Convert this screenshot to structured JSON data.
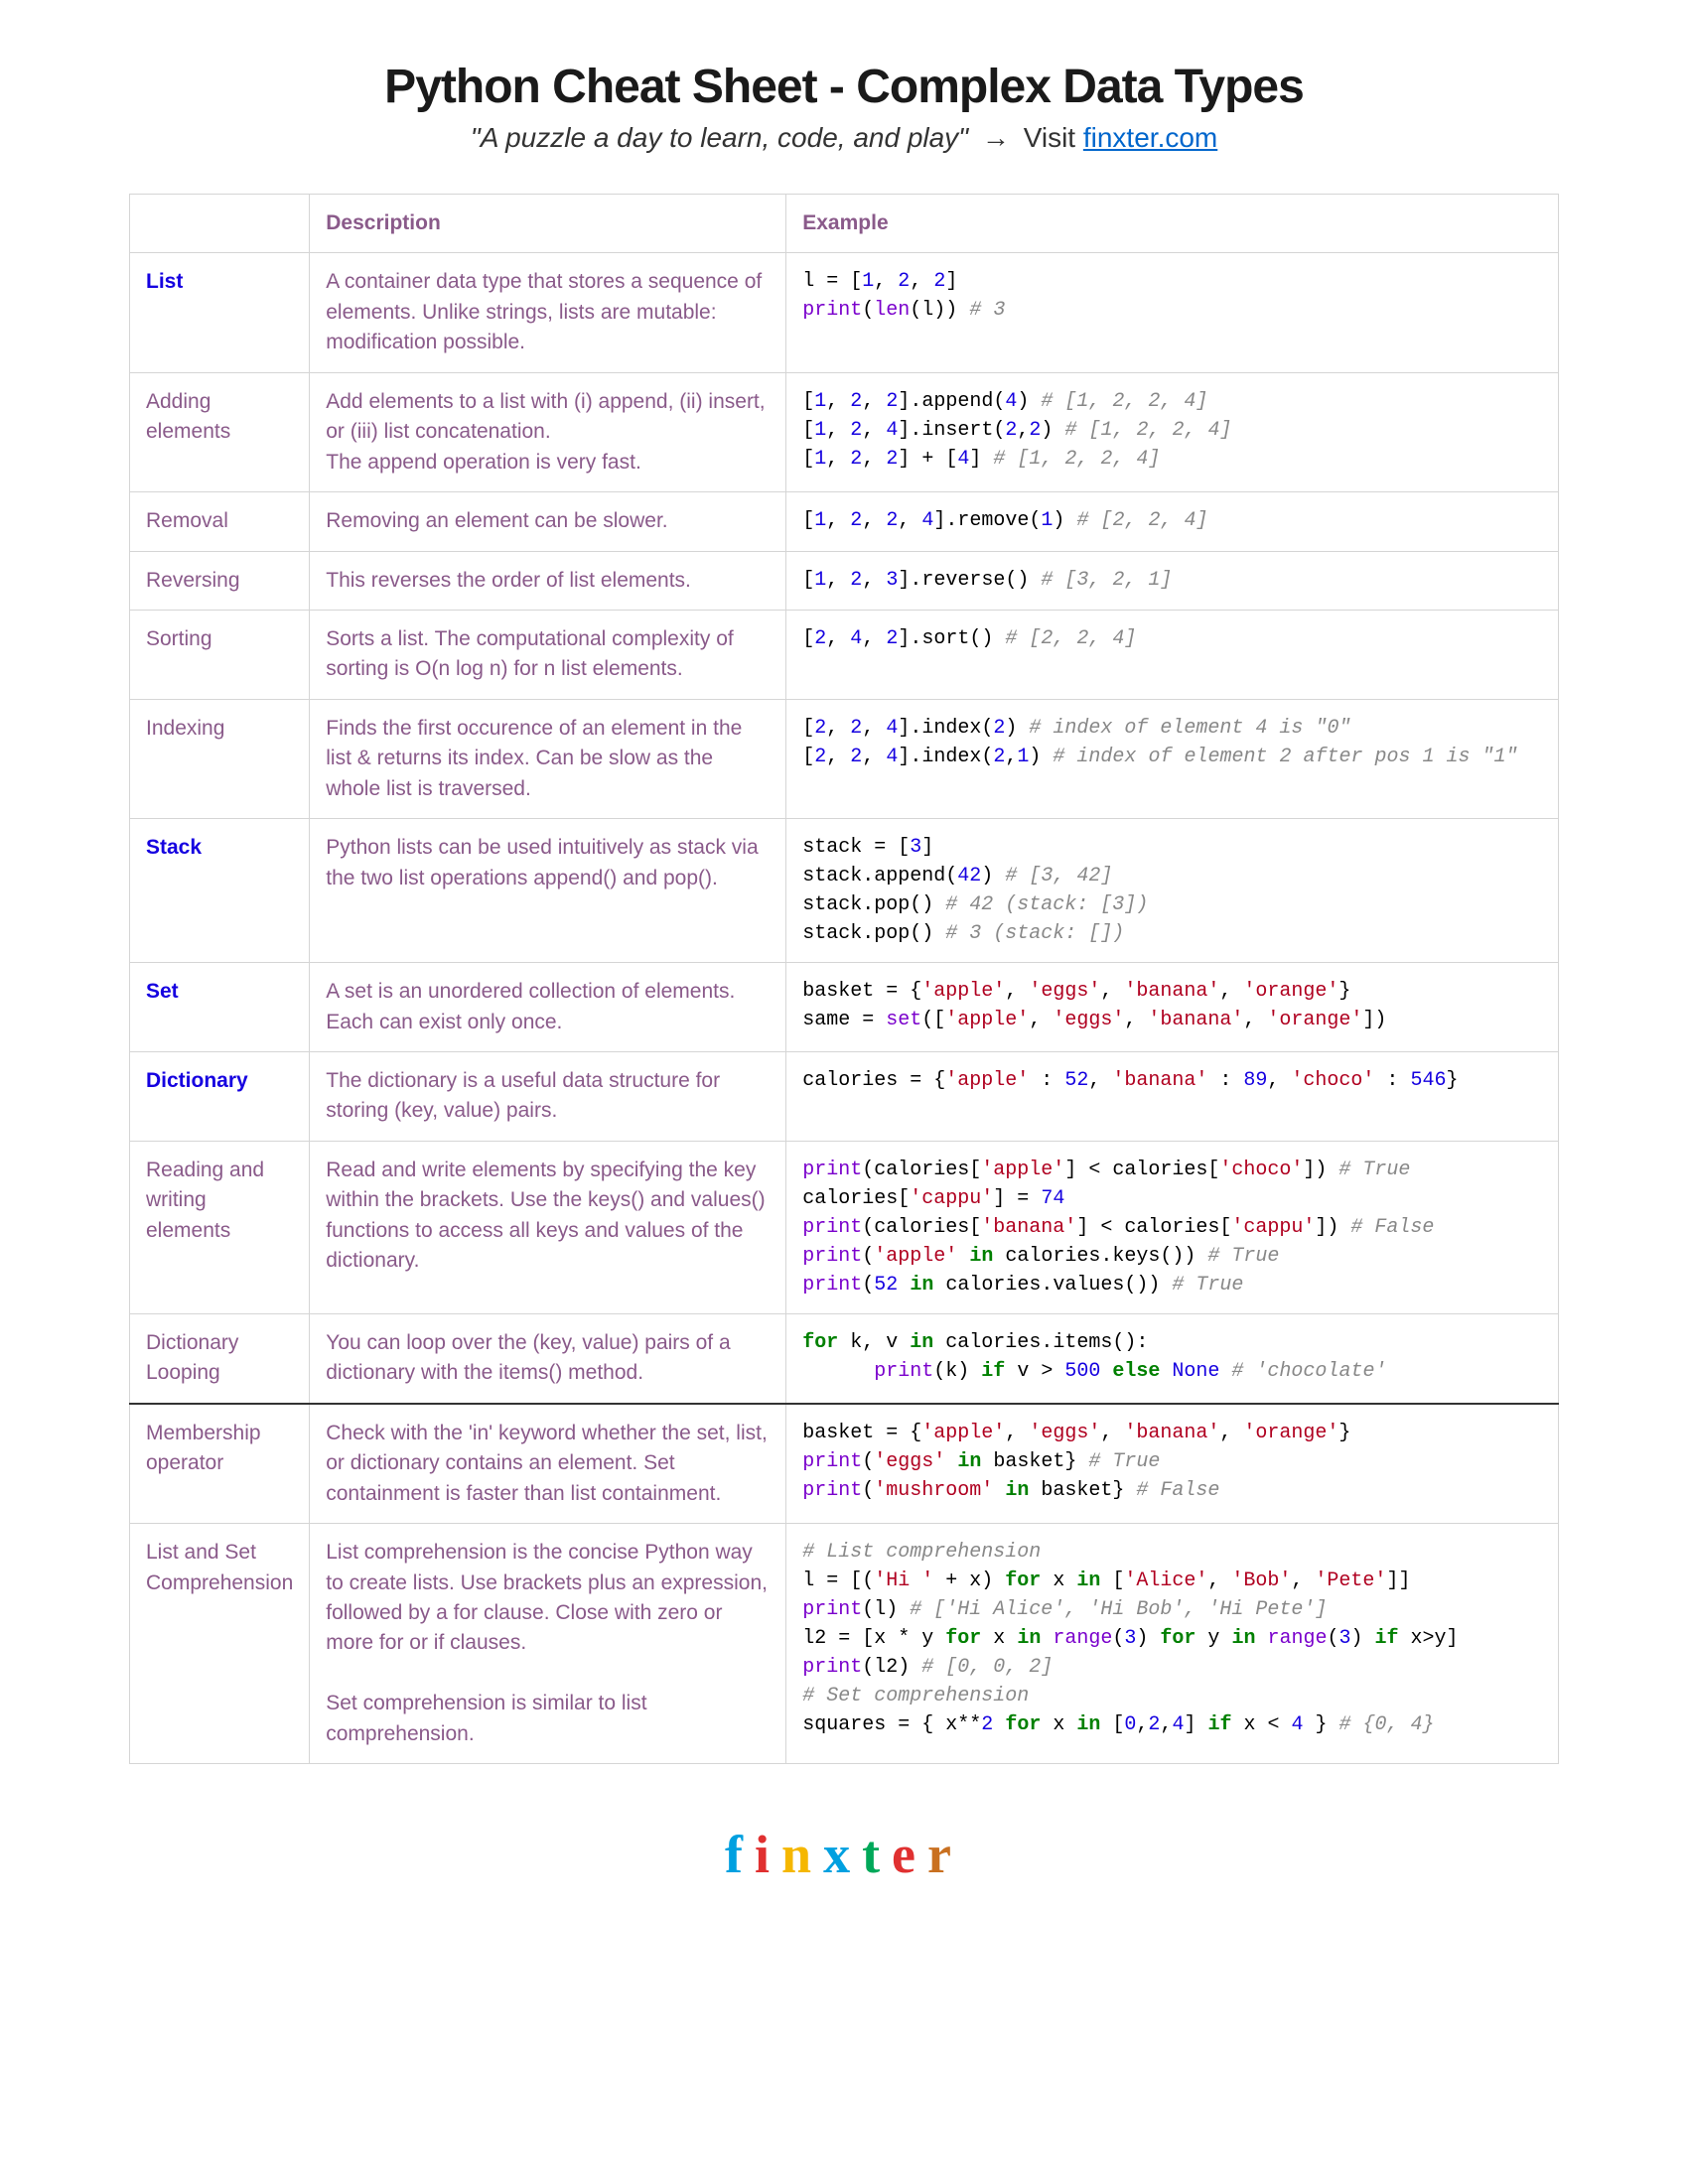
{
  "header": {
    "title": "Python Cheat Sheet - Complex Data Types",
    "quote": "\"A puzzle a day to learn, code, and play\"",
    "arrow": "→",
    "visit": "Visit ",
    "link_text": "finxter.com",
    "link_href": "https://finxter.com"
  },
  "columns": {
    "c1": "",
    "c2": "Description",
    "c3": "Example"
  },
  "rows": [
    {
      "name": "List",
      "bold_blue": true,
      "desc": "A container data type that stores a sequence of elements. Unlike strings, lists are mutable: modification possible.",
      "code_id": "code-list"
    },
    {
      "name": "Adding elements",
      "desc": "Add elements to a list with (i) append, (ii) insert, or (iii) list concatenation.\nThe append operation is very fast.",
      "code_id": "code-adding"
    },
    {
      "name": "Removal",
      "desc": "Removing an element can be slower.",
      "code_id": "code-removal"
    },
    {
      "name": "Reversing",
      "desc": "This reverses the order of list elements.",
      "code_id": "code-reversing"
    },
    {
      "name": "Sorting",
      "desc": "Sorts a list. The computational complexity of sorting is O(n log n) for n list elements.",
      "code_id": "code-sorting"
    },
    {
      "name": "Indexing",
      "desc": "Finds the first occurence of an element in the list & returns its index. Can be slow as the whole list is traversed.",
      "code_id": "code-indexing"
    },
    {
      "name": "Stack",
      "bold_blue": true,
      "desc": "Python lists can be used intuitively as stack via the two list operations append() and pop().",
      "code_id": "code-stack"
    },
    {
      "name": "Set",
      "bold_blue": true,
      "desc": "A set is an unordered collection of elements. Each can exist only once.",
      "code_id": "code-set"
    },
    {
      "name": "Dictionary",
      "bold_blue": true,
      "desc": "The dictionary is a useful data structure for storing (key, value) pairs.",
      "code_id": "code-dict"
    },
    {
      "name": "Reading and writing elements",
      "desc": "Read and write elements by specifying the key within the brackets. Use the keys() and values() functions to access all keys and values of the dictionary.",
      "code_id": "code-rw"
    },
    {
      "name": "Dictionary Looping",
      "desc": "You can loop over the (key, value) pairs of a dictionary with the items() method.",
      "code_id": "code-loop"
    },
    {
      "name": "Membership operator",
      "sep_top": true,
      "desc": "Check with the 'in' keyword whether the set, list, or dictionary contains an element. Set containment is faster than list containment.",
      "code_id": "code-member"
    },
    {
      "name": "List and Set Comprehension",
      "desc": "List comprehension is the concise Python way to create lists. Use brackets plus an expression, followed by a for clause. Close with zero or more for or if clauses.\n\nSet comprehension is similar to list comprehension.",
      "code_id": "code-comp"
    }
  ],
  "footer": {
    "letters": [
      "f",
      "i",
      "n",
      "x",
      "t",
      "e",
      "r"
    ]
  }
}
